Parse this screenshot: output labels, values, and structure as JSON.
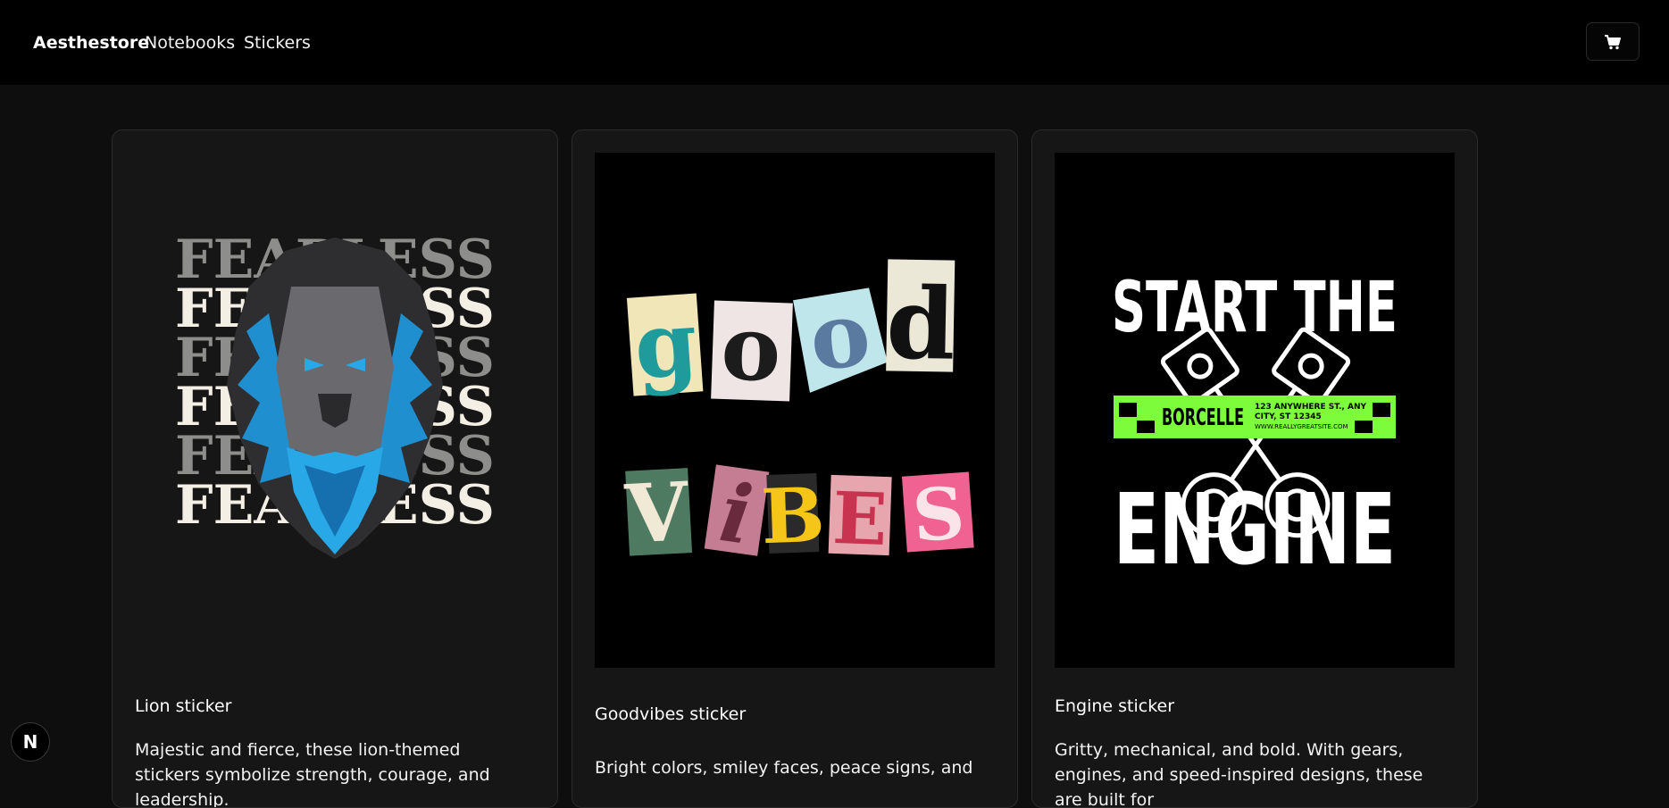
{
  "header": {
    "brand": "Aesthestore",
    "links": [
      "Notebooks",
      "Stickers"
    ],
    "cart_icon": "shopping-cart-icon"
  },
  "products": [
    {
      "title": "Lion sticker",
      "description": "Majestic and fierce, these lion-themed stickers symbolize strength, courage, and leadership.",
      "image_text": [
        "FEARLESS",
        "FEARLESS",
        "FEARLESS",
        "FEARLESS",
        "FEARLESS",
        "FEARLESS"
      ]
    },
    {
      "title": "Goodvibes sticker",
      "description": "Bright colors, smiley faces, peace signs, and",
      "image_text": [
        "g",
        "o",
        "o",
        "d",
        "V",
        "i",
        "B",
        "E",
        "S"
      ]
    },
    {
      "title": "Engine sticker",
      "description": "Gritty, mechanical, and bold. With gears, engines, and speed-inspired designs, these are built for",
      "image_text": {
        "top": "START THE",
        "bottom": "ENGINE",
        "banner_brand": "BORCELLE",
        "banner_address_1": "123 ANYWHERE ST., ANY",
        "banner_address_2": "CITY, ST 12345",
        "banner_site": "WWW.REALLYGREATSITE.COM"
      }
    }
  ],
  "dev_badge": "N",
  "colors": {
    "page_bg": "#0e0e0e",
    "nav_bg": "#000000",
    "card_bg": "#161616",
    "lion_blue": "#29a8e8",
    "engine_green": "#7cfc3a"
  }
}
